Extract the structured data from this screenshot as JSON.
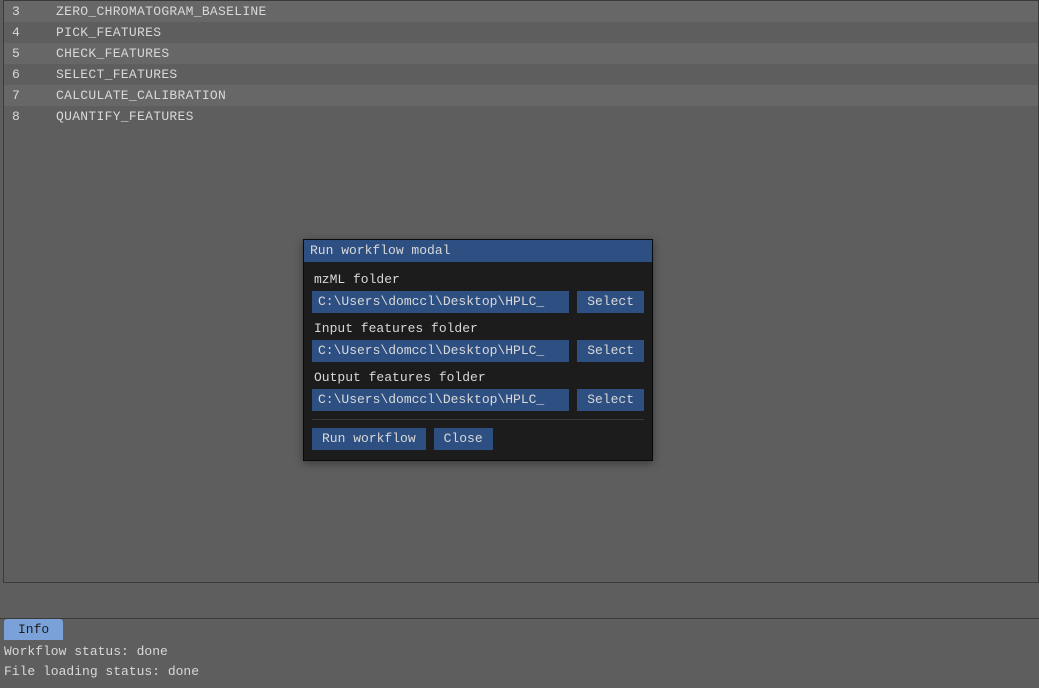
{
  "table": {
    "rows": [
      {
        "index": "3",
        "step": "ZERO_CHROMATOGRAM_BASELINE"
      },
      {
        "index": "4",
        "step": "PICK_FEATURES"
      },
      {
        "index": "5",
        "step": "CHECK_FEATURES"
      },
      {
        "index": "6",
        "step": "SELECT_FEATURES"
      },
      {
        "index": "7",
        "step": "CALCULATE_CALIBRATION"
      },
      {
        "index": "8",
        "step": "QUANTIFY_FEATURES"
      }
    ]
  },
  "modal": {
    "title": "Run workflow modal",
    "fields": [
      {
        "label": "mzML folder",
        "value": "C:\\Users\\domccl\\Desktop\\HPLC_",
        "select_label": "Select"
      },
      {
        "label": "Input features folder",
        "value": "C:\\Users\\domccl\\Desktop\\HPLC_",
        "select_label": "Select"
      },
      {
        "label": "Output features folder",
        "value": "C:\\Users\\domccl\\Desktop\\HPLC_",
        "select_label": "Select"
      }
    ],
    "actions": {
      "run": "Run workflow",
      "close": "Close"
    }
  },
  "info": {
    "tab_label": "Info",
    "lines": [
      "Workflow status: done",
      "File loading status: done"
    ],
    "tab_color": "#7aa2d9"
  }
}
